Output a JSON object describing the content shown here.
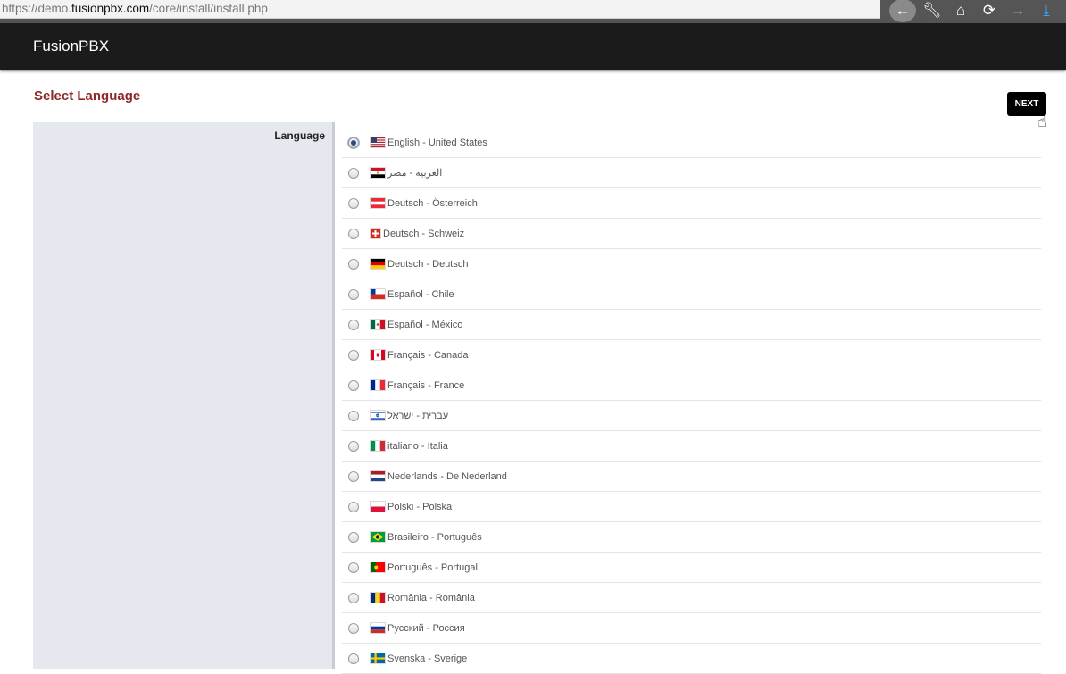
{
  "browser": {
    "url_prefix": "https://demo.",
    "url_host": "fusionpbx.com",
    "url_path": "/core/install/install.php"
  },
  "header": {
    "brand": "FusionPBX"
  },
  "page": {
    "title": "Select Language",
    "next_label": "NEXT",
    "field_label": "Language"
  },
  "languages": [
    {
      "label": "English - United States",
      "flag": "us",
      "selected": true
    },
    {
      "label": "العربية - مصر",
      "flag": "eg",
      "selected": false
    },
    {
      "label": "Deutsch - Österreich",
      "flag": "at",
      "selected": false
    },
    {
      "label": "Deutsch - Schweiz",
      "flag": "ch",
      "selected": false
    },
    {
      "label": "Deutsch - Deutsch",
      "flag": "de",
      "selected": false
    },
    {
      "label": "Español - Chile",
      "flag": "cl",
      "selected": false
    },
    {
      "label": "Español - México",
      "flag": "mx",
      "selected": false
    },
    {
      "label": "Français - Canada",
      "flag": "ca",
      "selected": false
    },
    {
      "label": "Français - France",
      "flag": "fr",
      "selected": false
    },
    {
      "label": "עברית - ישראל",
      "flag": "il",
      "selected": false
    },
    {
      "label": "italiano - Italia",
      "flag": "it",
      "selected": false
    },
    {
      "label": "Nederlands - De Nederland",
      "flag": "nl",
      "selected": false
    },
    {
      "label": "Polski - Polska",
      "flag": "pl",
      "selected": false
    },
    {
      "label": "Brasileiro - Português",
      "flag": "br",
      "selected": false
    },
    {
      "label": "Português - Portugal",
      "flag": "pt",
      "selected": false
    },
    {
      "label": "România - România",
      "flag": "ro",
      "selected": false
    },
    {
      "label": "Русский - Россия",
      "flag": "ru",
      "selected": false
    },
    {
      "label": "Svenska - Sverige",
      "flag": "se",
      "selected": false
    }
  ],
  "colors": {
    "title": "#8c2a2a",
    "header_bg": "#1b1b1b",
    "label_bg": "#e5e9ef"
  }
}
